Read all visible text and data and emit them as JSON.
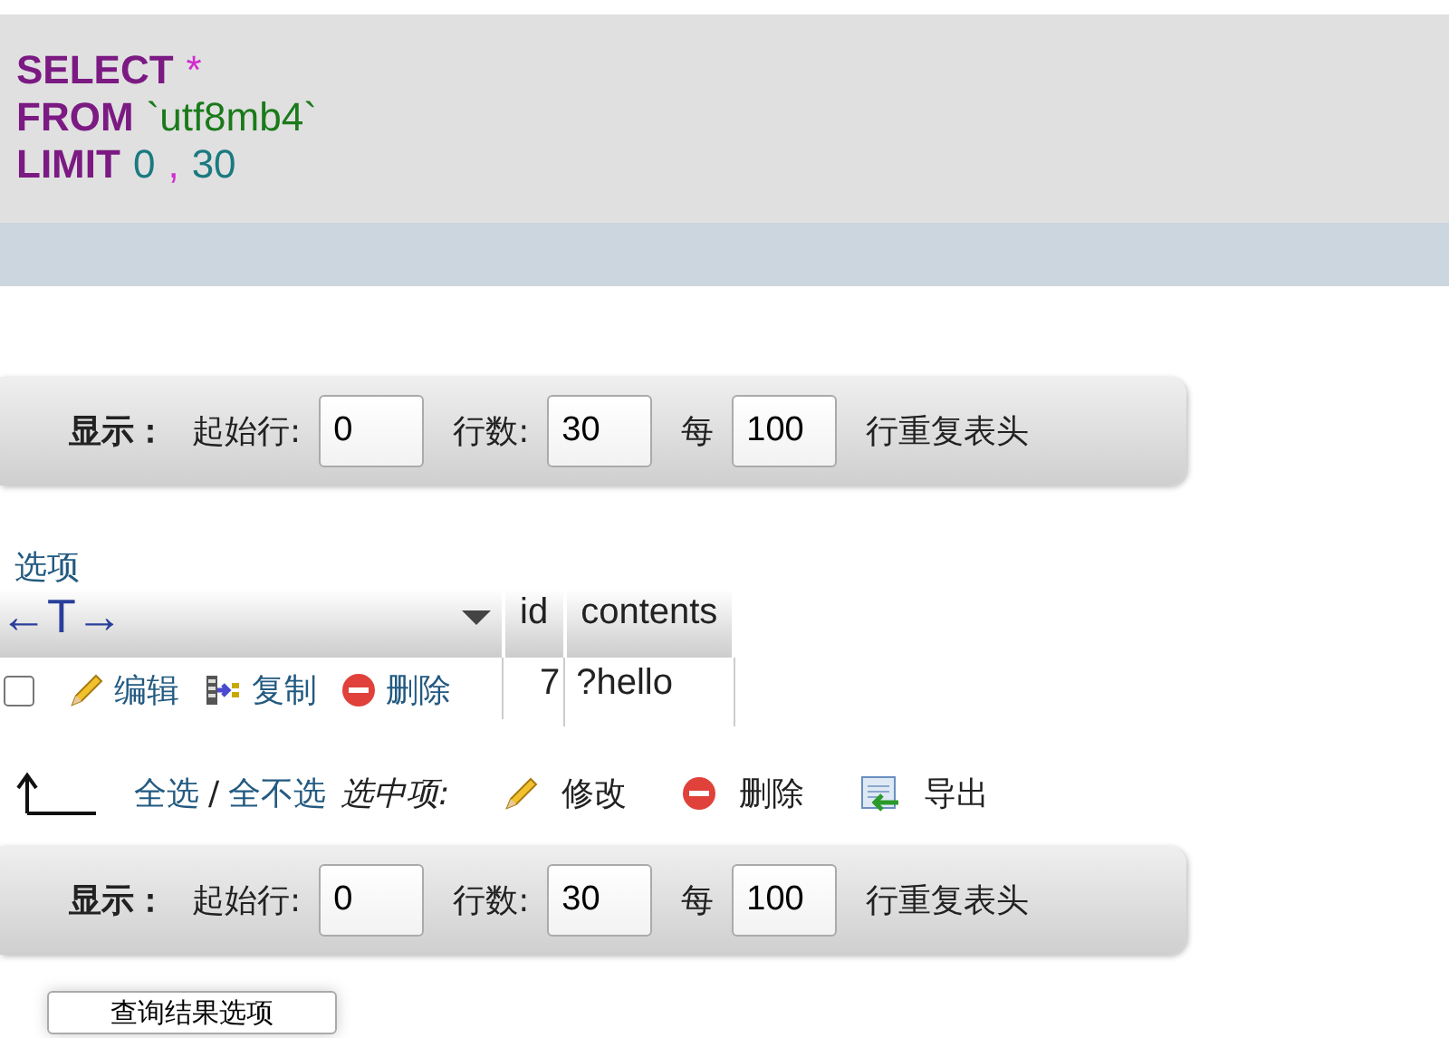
{
  "sql": {
    "lines": [
      [
        {
          "kind": "keyword",
          "text": "SELECT"
        },
        {
          "kind": "operator",
          "text": "*"
        }
      ],
      [
        {
          "kind": "keyword",
          "text": "FROM"
        },
        {
          "kind": "identifier",
          "text": "`utf8mb4`"
        }
      ],
      [
        {
          "kind": "keyword",
          "text": "LIMIT"
        },
        {
          "kind": "number",
          "text": "0"
        },
        {
          "kind": "punct",
          "text": ","
        },
        {
          "kind": "number",
          "text": "30"
        }
      ]
    ]
  },
  "nav_bars": [
    {
      "label": "显示：",
      "fields": [
        {
          "label": "起始行:",
          "value": "0"
        },
        {
          "label": "行数:",
          "value": "30"
        },
        {
          "label": "每",
          "value": "100"
        }
      ],
      "suffix": "行重复表头"
    },
    {
      "label": "显示：",
      "fields": [
        {
          "label": "起始行:",
          "value": "0"
        },
        {
          "label": "行数:",
          "value": "30"
        },
        {
          "label": "每",
          "value": "100"
        }
      ],
      "suffix": "行重复表头"
    }
  ],
  "options_link": "选项",
  "table": {
    "action_header": "←T→",
    "columns": [
      "id",
      "contents"
    ],
    "rows": [
      {
        "checked": false,
        "actions": [
          {
            "kind": "edit",
            "label": "编辑"
          },
          {
            "kind": "copy",
            "label": "复制"
          },
          {
            "kind": "delete",
            "label": "删除"
          }
        ],
        "cells": [
          "7",
          "?hello"
        ]
      }
    ]
  },
  "bulk": {
    "check_all": "全选",
    "separator": "/",
    "uncheck_all": "全不选",
    "with_selected": "选中项:",
    "actions": [
      {
        "kind": "edit",
        "label": "修改"
      },
      {
        "kind": "delete",
        "label": "删除"
      },
      {
        "kind": "export",
        "label": "导出"
      }
    ]
  },
  "query_options_button": "查询结果选项"
}
